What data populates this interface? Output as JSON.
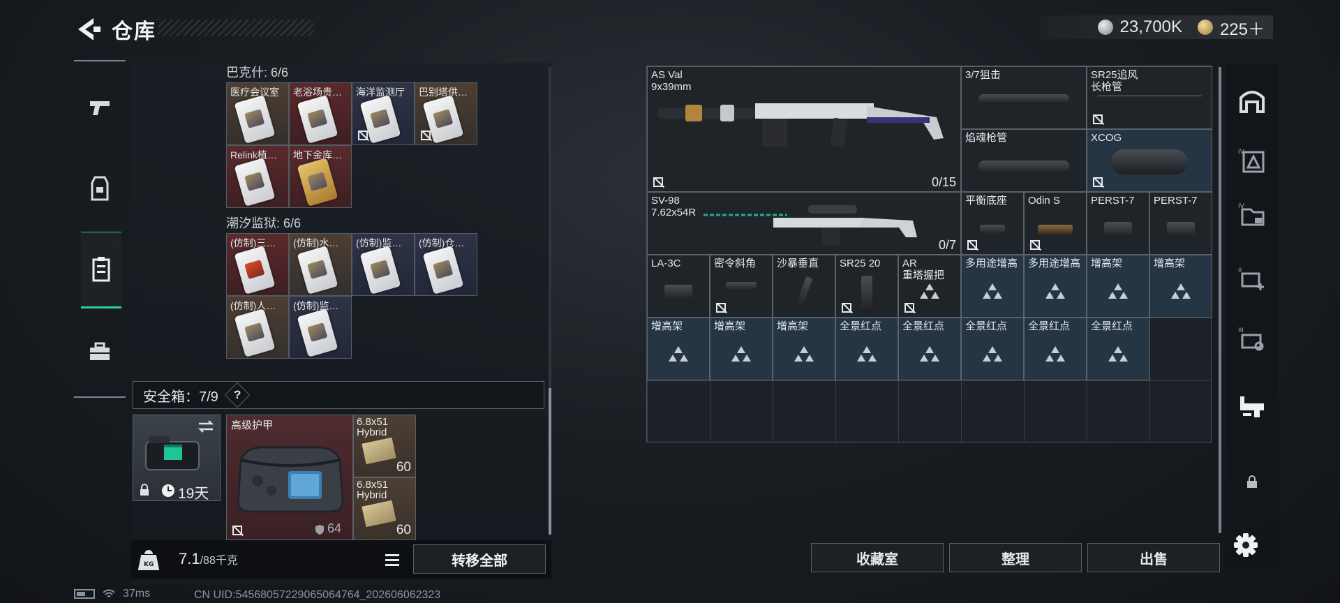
{
  "header": {
    "title": "仓库",
    "currency_silver": "23,700K",
    "currency_gold": "225＋"
  },
  "storage": {
    "section1": {
      "label": "巴克什: 6/6",
      "items": [
        {
          "name": "医疗会议室",
          "color": "tan"
        },
        {
          "name": "老浴场贵…",
          "color": "red"
        },
        {
          "name": "海洋监测厅",
          "color": "navy"
        },
        {
          "name": "巴别塔供…",
          "color": "tan"
        },
        {
          "name": "Relink植…",
          "color": "red"
        },
        {
          "name": "地下金库…",
          "color": "red"
        }
      ]
    },
    "section2": {
      "label": "潮汐监狱: 6/6",
      "items": [
        {
          "name": "(仿制)三…",
          "color": "red"
        },
        {
          "name": "(仿制)水…",
          "color": "tan"
        },
        {
          "name": "(仿制)监…",
          "color": "navy"
        },
        {
          "name": "(仿制)仓…",
          "color": "navy"
        },
        {
          "name": "(仿制)人…",
          "color": "tan"
        },
        {
          "name": "(仿制)监…",
          "color": "navy"
        }
      ]
    }
  },
  "safe_box": {
    "label": "安全箱：7/9",
    "help": "?",
    "container_timer": "19天",
    "armor_name": "高级护甲",
    "armor_durability": "64",
    "ammo1_name": "6.8x51\nHybrid",
    "ammo1_count": "60",
    "ammo2_name": "6.8x51\nHybrid",
    "ammo2_count": "60"
  },
  "weight": {
    "value": "7.1",
    "capacity": "/88千克"
  },
  "buttons": {
    "transfer_all": "转移全部",
    "collection": "收藏室",
    "organize": "整理",
    "sell": "出售"
  },
  "grid": {
    "weapon1": {
      "name": "AS Val\n9x39mm",
      "count": "0/15"
    },
    "weapon2": {
      "name": "SV-98\n7.62x54R",
      "count": "0/7"
    },
    "items": {
      "scope37": "3/7狙击",
      "sr25_barrel": "SR25追风\n长枪管",
      "flame_barrel": "焰魂枪管",
      "xcog": "XCOG",
      "balance_mount": "平衡底座",
      "odin": "Odin S",
      "perst1": "PERST-7",
      "perst2": "PERST-7",
      "la3c": "LA-3C",
      "angled_grip": "密令斜角",
      "sandstorm": "沙暴垂直",
      "sr25mag": "SR25 20",
      "ar_grip": "AR\n重塔握把",
      "multi1": "多用途增高",
      "multi2": "多用途增高",
      "riser_a": "增高架",
      "riser_b": "增高架",
      "riser_c": "增高架",
      "riser_d": "增高架",
      "riser_e": "增高架",
      "reddot1": "全景红点",
      "reddot2": "全景红点",
      "reddot3": "全景红点",
      "reddot4": "全景红点",
      "reddot5": "全景红点"
    }
  },
  "status": {
    "ping": "37ms",
    "uid": "CN UID:54568057229065064764_202606062323"
  },
  "colors": {
    "accent": "#2ccf9f",
    "red_cell": "#5a2a2c",
    "tan_cell": "#4d3e33",
    "navy_cell": "#2e3346",
    "blue_cell": "#263544"
  }
}
